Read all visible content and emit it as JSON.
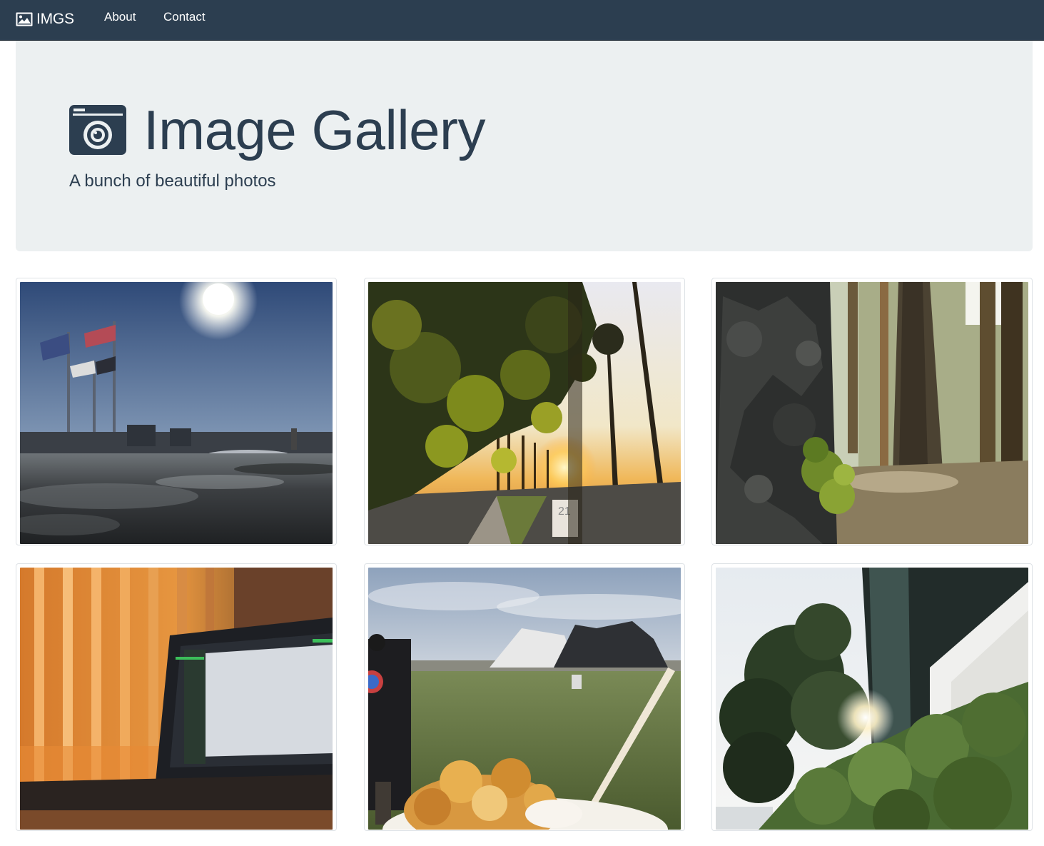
{
  "navbar": {
    "brand": "IMGS",
    "brand_icon": "image-icon",
    "links": [
      {
        "label": "About"
      },
      {
        "label": "Contact"
      }
    ],
    "background": "#2c3e50"
  },
  "jumbotron": {
    "title": "Image Gallery",
    "title_icon": "camera-icon",
    "subtitle": "A bunch of beautiful photos",
    "background": "#ecf0f1",
    "text_color": "#2c3e50"
  },
  "gallery": {
    "photos": [
      {
        "icon": "photo-flags-waterfront"
      },
      {
        "icon": "photo-palm-sunset-street"
      },
      {
        "icon": "photo-moss-tree-bark"
      },
      {
        "icon": "photo-laptop-blinds"
      },
      {
        "icon": "photo-park-dessert"
      },
      {
        "icon": "photo-tree-sun-shrub"
      }
    ]
  }
}
